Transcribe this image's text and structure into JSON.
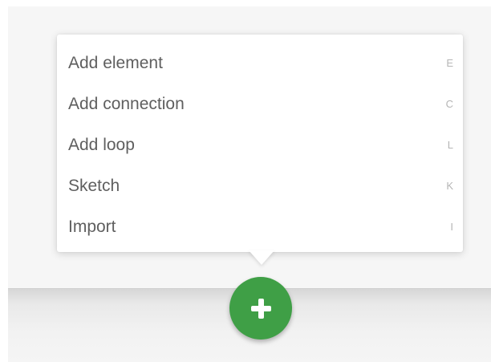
{
  "add_menu": {
    "items": [
      {
        "label": "Add element",
        "shortcut": "E"
      },
      {
        "label": "Add connection",
        "shortcut": "C"
      },
      {
        "label": "Add loop",
        "shortcut": "L"
      },
      {
        "label": "Sketch",
        "shortcut": "K"
      },
      {
        "label": "Import",
        "shortcut": "I"
      }
    ]
  },
  "add_button": {
    "icon": "plus-icon",
    "color": "#3f9f46"
  }
}
